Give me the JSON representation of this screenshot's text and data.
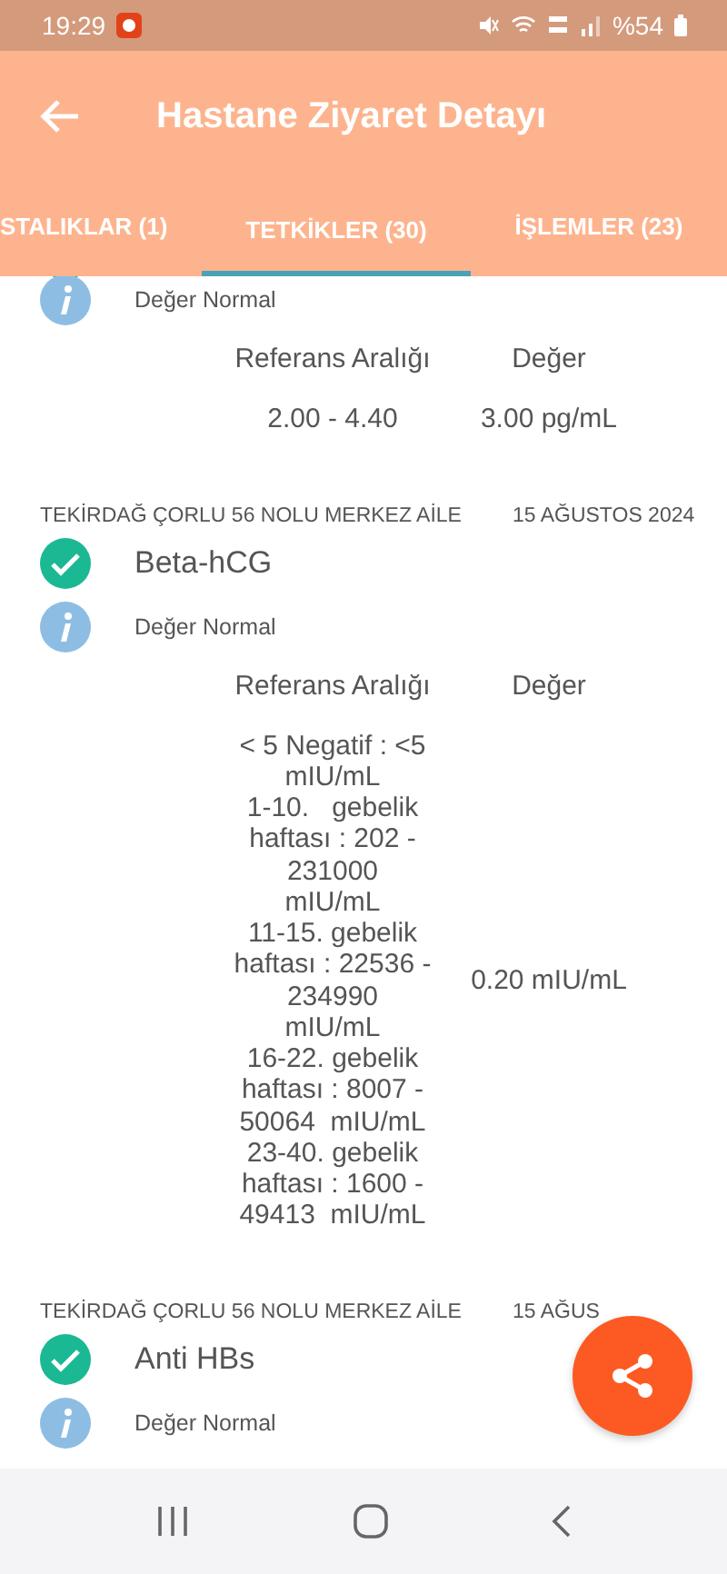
{
  "status_bar": {
    "time": "19:29",
    "battery": "%54"
  },
  "app_bar": {
    "title": "Hastane Ziyaret Detayı"
  },
  "tabs": [
    {
      "label": "STALIKLAR (1)",
      "selected": false
    },
    {
      "label": "TETKİKLER (30)",
      "selected": true
    },
    {
      "label": "İŞLEMLER (23)",
      "selected": false
    }
  ],
  "tests": [
    {
      "note": "Değer Normal",
      "range_header": "Referans Aralığı",
      "value_header": "Değer",
      "range": "2.00 - 4.40",
      "value": "3.00 pg/mL"
    },
    {
      "facility": "TEKİRDAĞ ÇORLU 56 NOLU MERKEZ AİLE",
      "date": "15 AĞUSTOS 2024",
      "name": "Beta-hCG",
      "note": "Değer Normal",
      "range_header": "Referans Aralığı",
      "value_header": "Değer",
      "range": "< 5 Negatif : <5 mIU/mL\n1-10.   gebelik haftası : 202 - 231000  mIU/mL\n11-15. gebelik haftası : 22536 - 234990  mIU/mL\n16-22. gebelik haftası : 8007 - 50064  mIU/mL\n23-40. gebelik haftası : 1600 - 49413  mIU/mL",
      "value": "0.20 mIU/mL"
    },
    {
      "facility": "TEKİRDAĞ ÇORLU 56 NOLU MERKEZ AİLE",
      "date": "15 AĞUS",
      "name": "Anti HBs",
      "note": "Değer Normal"
    }
  ]
}
